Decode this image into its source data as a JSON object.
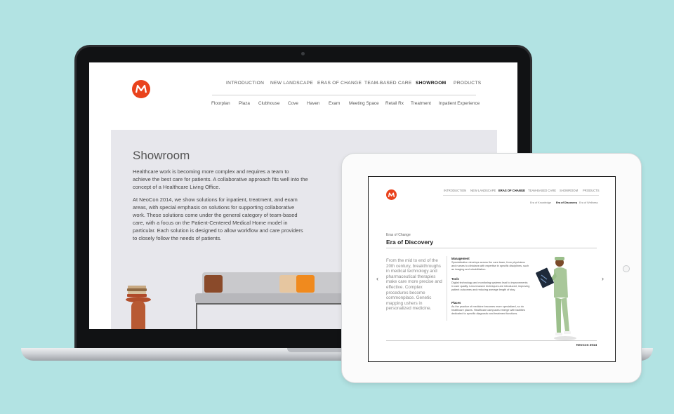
{
  "laptop": {
    "nav": [
      "INTRODUCTION",
      "NEW LANDSCAPE",
      "ERAS OF CHANGE",
      "TEAM-BASED CARE",
      "SHOWROOM",
      "PRODUCTS"
    ],
    "active_nav": "SHOWROOM",
    "subnav": [
      "Floorplan",
      "Plaza",
      "Clubhouse",
      "Cove",
      "Haven",
      "Exam",
      "Meeting Space",
      "Retail Rx",
      "Treatment",
      "Inpatient Experience"
    ],
    "title": "Showroom",
    "paragraph1": "Healthcare work is becoming more complex and requires a team to achieve the best care for patients. A collaborative approach fits well into the concept of a Healthcare Living Office.",
    "paragraph2": "At NeoCon 2014, we show solutions for inpatient, treatment, and exam areas, with special emphasis on solutions for supporting collaborative work. These solutions come under the general category of team-based care, with a focus on the Patient-Centered Medical Home model in particular. Each solution is designed to allow workflow and care providers to closely follow the needs of patients."
  },
  "tablet": {
    "nav": [
      "INTRODUCTION",
      "NEW LANDSCAPE",
      "ERAS OF CHANGE",
      "TEAM-BASED CARE",
      "SHOWROOM",
      "PRODUCTS"
    ],
    "active_nav": "ERAS OF CHANGE",
    "subnav": [
      "Era of Knowledge",
      "Era of Discovery",
      "Era of Wellness"
    ],
    "eyebrow": "Eras of Change",
    "title": "Era of Discovery",
    "intro": "From the mid to end of the 20th century, breakthroughs in medical technology and pharmaceutical therapies make care more precise and effective. Complex procedures become commonplace. Genetic mapping ushers in personalized medicine.",
    "sections": [
      {
        "heading": "Management",
        "body": "Specialization develops across the care team, from physicians and nurses to clinicians with expertise in specific disciplines, such as imaging and rehabilitation."
      },
      {
        "heading": "Tools",
        "body": "Digital technology and monitoring systems lead to improvements in care quality. Less invasive techniques are introduced, improving patient outcomes and reducing average length of stay."
      },
      {
        "heading": "Places",
        "body": "As the practice of medicine becomes more specialized, so do healthcare places. Healthcare campuses emerge with facilities dedicated to specific diagnostic and treatment functions."
      }
    ],
    "prev_arrow": "‹",
    "next_arrow": "›",
    "footer_brand": "NeoCon 2014"
  },
  "colors": {
    "background": "#b2e3e3",
    "brand": "#e9421c",
    "panel": "#e7e7ec"
  }
}
